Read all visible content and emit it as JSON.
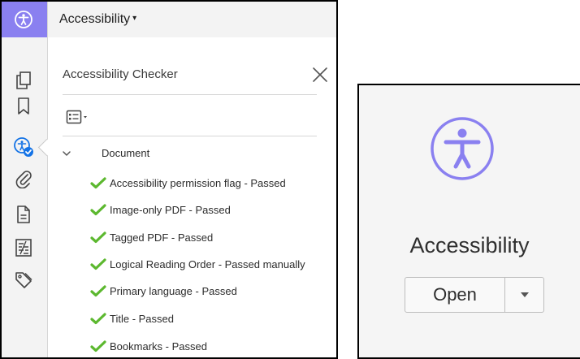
{
  "left_panel": {
    "header": {
      "title": "Accessibility",
      "caret": "▾"
    },
    "checker": {
      "title": "Accessibility Checker"
    },
    "tree": {
      "root_label": "Document",
      "items": [
        {
          "label": "Accessibility permission flag - Passed"
        },
        {
          "label": "Image-only PDF - Passed"
        },
        {
          "label": "Tagged PDF - Passed"
        },
        {
          "label": "Logical Reading Order - Passed manually"
        },
        {
          "label": "Primary language - Passed"
        },
        {
          "label": "Title - Passed"
        },
        {
          "label": "Bookmarks - Passed"
        }
      ]
    },
    "rail_icons": [
      "accessibility-icon",
      "pages-icon",
      "bookmark-icon",
      "accessibility-checker-icon",
      "attachment-icon",
      "document-properties-icon",
      "compare-icon",
      "tag-icon"
    ]
  },
  "right_panel": {
    "label": "Accessibility",
    "open_button": "Open"
  },
  "colors": {
    "accent": "#8a80f0",
    "pass_check": "#5cb82f",
    "rail_bg": "#f3f3f3",
    "active_badge": "#1473e6"
  }
}
